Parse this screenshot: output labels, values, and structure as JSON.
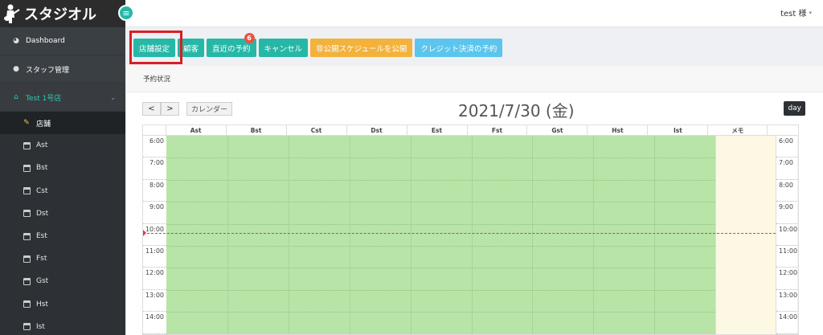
{
  "brand": {
    "name": "スタジオル"
  },
  "header": {
    "user": "test 様",
    "caret": "▾",
    "menu_icon": "hamburger-icon"
  },
  "sidebar": {
    "dashboard": "Dashboard",
    "staff": "スタッフ管理",
    "store": "Test 1号店",
    "store_chevron": "⌄",
    "items": [
      {
        "label": "店舗",
        "icon": "wrench-icon",
        "active": true
      },
      {
        "label": "Ast",
        "icon": "calendar-icon"
      },
      {
        "label": "Bst",
        "icon": "calendar-icon"
      },
      {
        "label": "Cst",
        "icon": "calendar-icon"
      },
      {
        "label": "Dst",
        "icon": "calendar-icon"
      },
      {
        "label": "Est",
        "icon": "calendar-icon"
      },
      {
        "label": "Fst",
        "icon": "calendar-icon"
      },
      {
        "label": "Gst",
        "icon": "calendar-icon"
      },
      {
        "label": "Hst",
        "icon": "calendar-icon"
      },
      {
        "label": "Ist",
        "icon": "calendar-icon"
      }
    ]
  },
  "toolbar": {
    "buttons": [
      {
        "label": "店舗設定",
        "color": "#26b7a6"
      },
      {
        "label": "顧客",
        "color": "#26b7a6"
      },
      {
        "label": "直近の予約",
        "color": "#26b7a6",
        "badge": "6"
      },
      {
        "label": "キャンセル",
        "color": "#26b7a6"
      },
      {
        "label": "非公開スケジュールを公開",
        "color": "#f3b23c"
      },
      {
        "label": "クレジット決済の予約",
        "color": "#5bc5ee"
      }
    ]
  },
  "panel": {
    "title": "予約状況"
  },
  "calendar": {
    "prev": "<",
    "next": ">",
    "calendar_button": "カレンダー",
    "title": "2021/7/30 (金)",
    "view_button": "day",
    "columns": [
      "Ast",
      "Bst",
      "Cst",
      "Dst",
      "Est",
      "Fst",
      "Gst",
      "Hst",
      "Ist",
      "メモ"
    ],
    "times": [
      "6:00",
      "7:00",
      "8:00",
      "9:00",
      "10:00",
      "11:00",
      "12:00",
      "13:00",
      "14:00"
    ],
    "scroll_up": "▲"
  }
}
